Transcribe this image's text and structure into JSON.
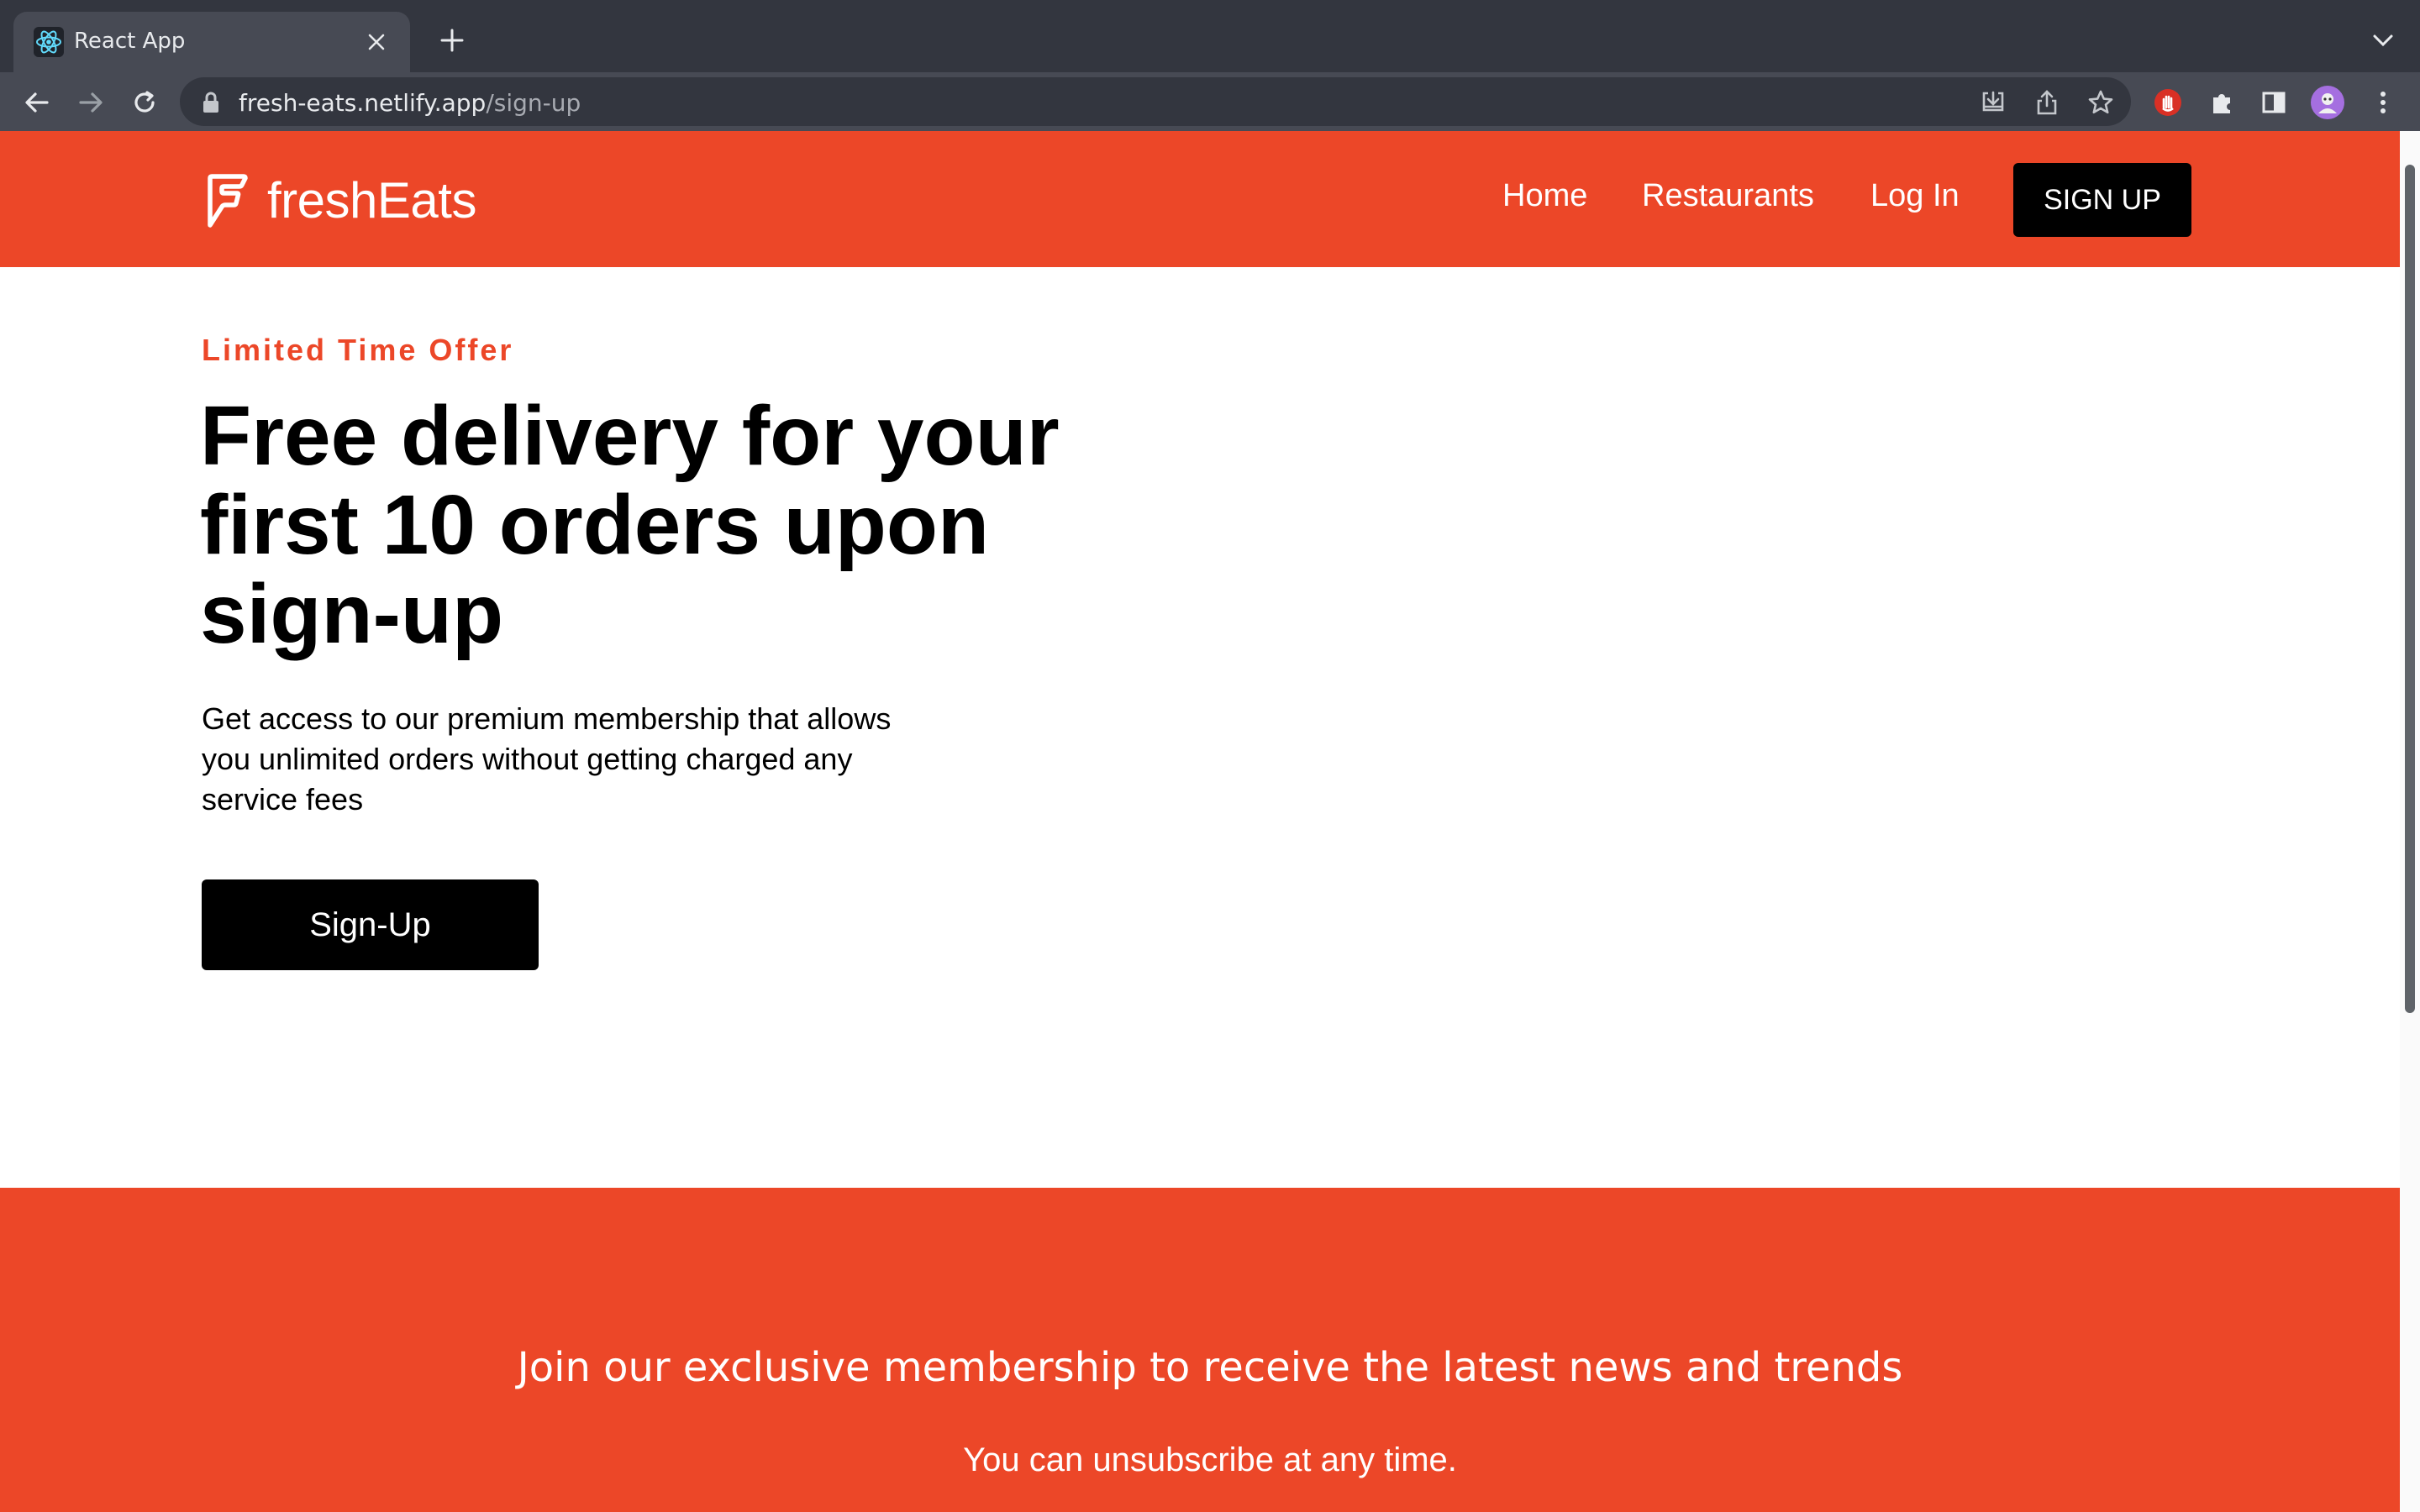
{
  "browser": {
    "tab": {
      "title": "React App",
      "favicon": "react-logo-icon"
    },
    "url": {
      "domain": "fresh-eats.netlify.app",
      "path": "/sign-up"
    }
  },
  "header": {
    "brand": "freshEats",
    "nav": {
      "home": "Home",
      "restaurants": "Restaurants",
      "login": "Log In"
    },
    "signup_button": "SIGN UP"
  },
  "hero": {
    "eyebrow": "Limited Time Offer",
    "title": "Free delivery for your first 10 orders upon sign-up",
    "description": "Get access to our premium membership that allows you unlimited orders without getting charged any service fees",
    "cta": "Sign-Up"
  },
  "newsletter": {
    "heading": "Join our exclusive membership to receive the latest news and trends",
    "subtext": "You can unsubscribe at any time."
  },
  "colors": {
    "brand": "#ec4728",
    "button": "#000000"
  }
}
